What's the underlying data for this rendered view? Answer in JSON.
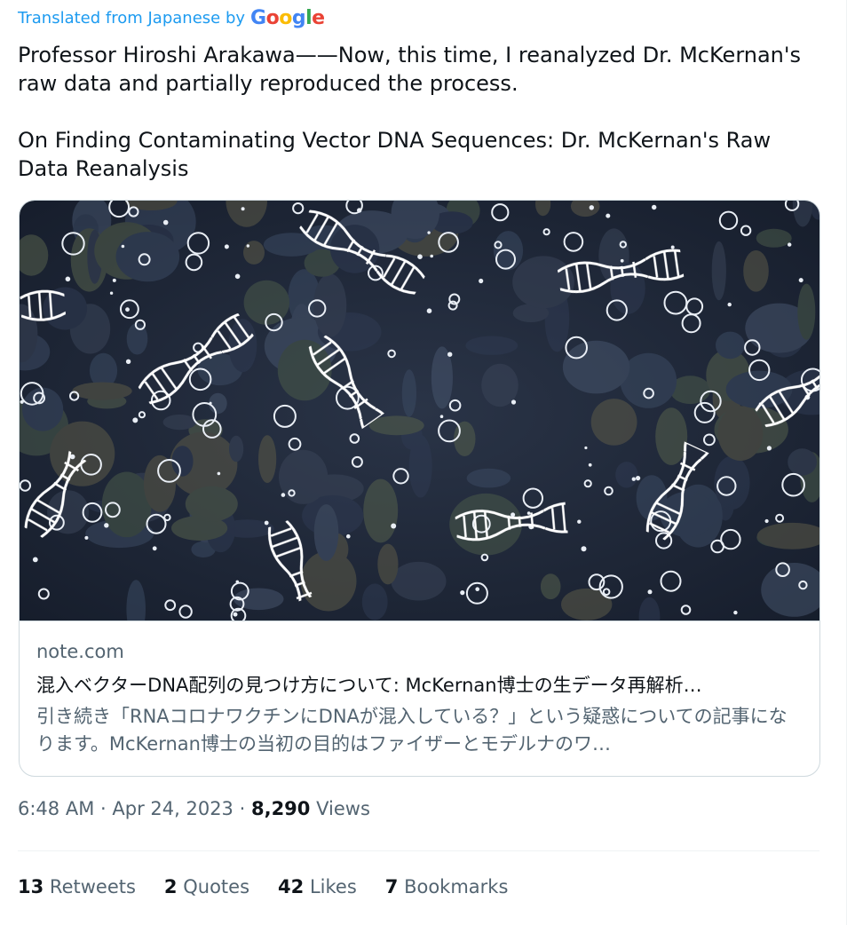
{
  "translation": {
    "label": "Translated from Japanese by",
    "brand_letters": [
      "G",
      "o",
      "o",
      "g",
      "l",
      "e"
    ]
  },
  "tweet": {
    "paragraph1": "Professor Hiroshi Arakawa——Now, this time, I reanalyzed Dr. McKernan's raw data and partially reproduced the process.",
    "paragraph2": "On Finding Contaminating Vector DNA Sequences: Dr. McKernan's Raw Data Reanalysis"
  },
  "card": {
    "image_subject": "dna-helix-illustration",
    "domain": "note.com",
    "title": "混入ベクターDNA配列の見つけ方について: McKernan博士の生データ再解析…",
    "description": "引き続き「RNAコロナワクチンにDNAが混入している？」という疑惑についての記事になります。McKernan博士の当初の目的はファイザーとモデルナのワ…"
  },
  "meta": {
    "time": "6:48 AM",
    "separator": "·",
    "date": "Apr 24, 2023",
    "views_count": "8,290",
    "views_label": "Views"
  },
  "stats": [
    {
      "count": "13",
      "label": "Retweets"
    },
    {
      "count": "2",
      "label": "Quotes"
    },
    {
      "count": "42",
      "label": "Likes"
    },
    {
      "count": "7",
      "label": "Bookmarks"
    }
  ],
  "colors": {
    "accent": "#1d9bf0",
    "text": "#0f1419",
    "secondary": "#536471",
    "border": "#cfd9de",
    "image_bg": "#1e2839"
  }
}
